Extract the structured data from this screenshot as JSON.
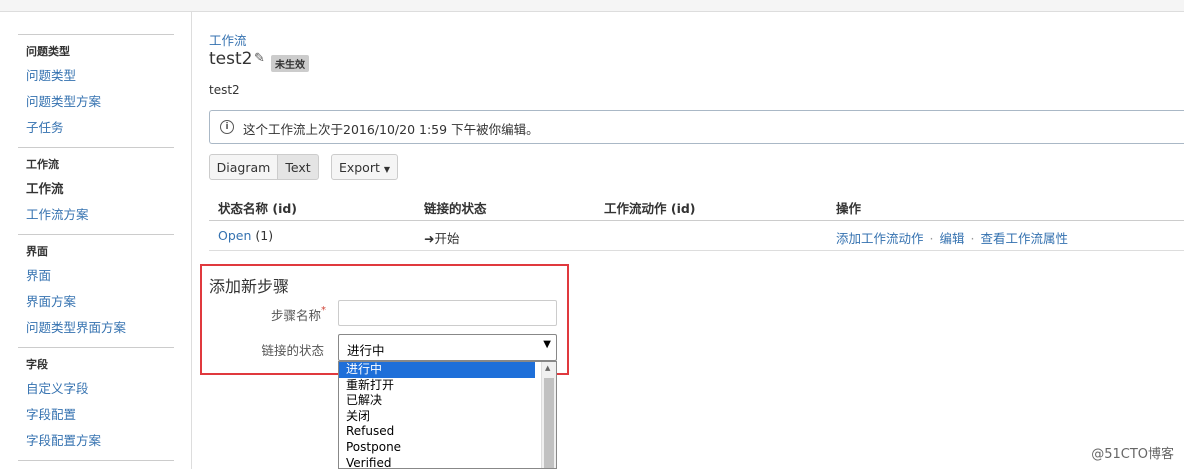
{
  "sidebar": {
    "groups": [
      {
        "heading": "问题类型",
        "items": [
          "问题类型",
          "问题类型方案",
          "子任务"
        ]
      },
      {
        "heading": "工作流",
        "items": [
          "工作流",
          "工作流方案"
        ]
      },
      {
        "heading": "界面",
        "items": [
          "界面",
          "界面方案",
          "问题类型界面方案"
        ]
      },
      {
        "heading": "字段",
        "items": [
          "自定义字段",
          "字段配置",
          "字段配置方案"
        ]
      }
    ]
  },
  "header": {
    "breadcrumb": "工作流",
    "title": "test2",
    "status_badge": "未生效",
    "description": "test2",
    "notice": "这个工作流上次于2016/10/20 1:59 下午被你编辑。"
  },
  "view_toggle": {
    "diagram": "Diagram",
    "text": "Text",
    "export": "Export"
  },
  "table": {
    "headers": [
      "状态名称 (id)",
      "链接的状态",
      "工作流动作 (id)",
      "操作"
    ],
    "row": {
      "status_name": "Open",
      "status_id": "(1)",
      "linked_state": "开始",
      "actions": [
        "添加工作流动作",
        "编辑",
        "查看工作流属性"
      ]
    }
  },
  "form": {
    "title": "添加新步骤",
    "step_name_label": "步骤名称",
    "required_mark": "*",
    "linked_state_label": "链接的状态",
    "selected_value": "进行中",
    "options": [
      "进行中",
      "重新打开",
      "已解决",
      "关闭",
      "Refused",
      "Postpone",
      "Verified"
    ]
  },
  "watermark": "@51CTO博客"
}
